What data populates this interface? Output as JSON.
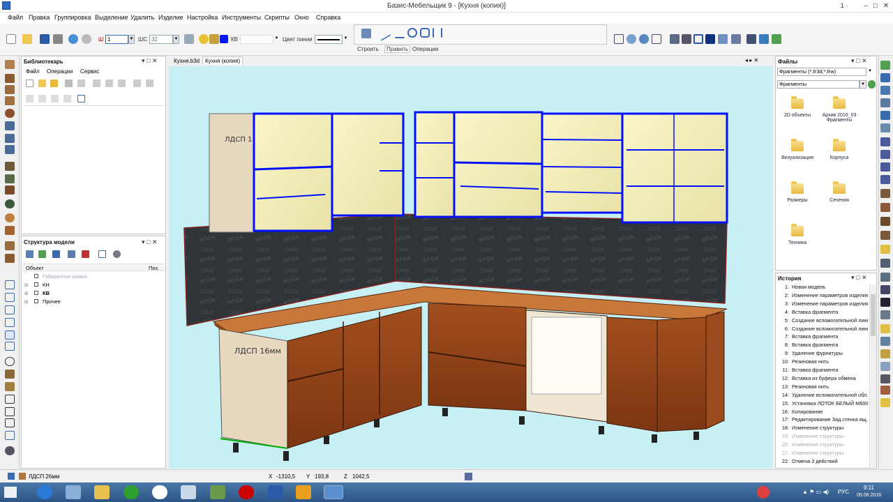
{
  "window": {
    "title": "Базис-Мебельщик 9 - [Кухня (копия)]",
    "version_indicator": "1 ·"
  },
  "menu": [
    "Файл",
    "Правка",
    "Группировка",
    "Выделение",
    "Удалить",
    "Изделие",
    "Настройка",
    "Инструменты",
    "Скрипты",
    "Окно",
    "Справка"
  ],
  "toolbar": {
    "w_label": "Ш",
    "w_value": "1",
    "ws_label": "ШС",
    "ws_value": "32",
    "kv_label": "КВ",
    "line_color_label": "Цвет линии",
    "tabs": [
      "Строить",
      "Править",
      "Операции"
    ]
  },
  "doc_tabs": [
    "Кухня.b3d",
    "Кухня (копия)"
  ],
  "librarian": {
    "title": "Библиотекарь",
    "menu": [
      "Файл",
      "Операции",
      "Сервис"
    ]
  },
  "model_structure": {
    "title": "Структура модели",
    "col_object": "Объект",
    "col_pos": "Поз.",
    "items": [
      {
        "label": "Габаритная рамка",
        "faded": true,
        "bold": false
      },
      {
        "label": "КН",
        "faded": false,
        "bold": false
      },
      {
        "label": "КВ",
        "faded": false,
        "bold": true
      },
      {
        "label": "Прочее",
        "faded": false,
        "bold": false
      }
    ]
  },
  "viewport": {
    "label_upper": "ЛДСП 1",
    "label_lower": "ЛДСП 16мм",
    "bg": "#c6f0f4"
  },
  "files": {
    "title": "Файлы",
    "filter": "Фрагменты (*.fr3d;*.frw)",
    "folder": "Фрагменты",
    "items": [
      "2D объекты",
      "Архив 2016_03 Фрагменты",
      "Визуализация",
      "Корпуса",
      "Размеры",
      "Сечения",
      "Техника"
    ]
  },
  "history": {
    "title": "История",
    "items": [
      {
        "n": "1:",
        "t": "Новая модель",
        "faded": false
      },
      {
        "n": "2:",
        "t": "Изменение параметров изделия",
        "faded": false
      },
      {
        "n": "3:",
        "t": "Изменение параметров изделия",
        "faded": false
      },
      {
        "n": "4:",
        "t": "Вставка фрагмента",
        "faded": false
      },
      {
        "n": "5:",
        "t": "Создание вспомогательной линии",
        "faded": false
      },
      {
        "n": "6:",
        "t": "Создание вспомогательной линии",
        "faded": false
      },
      {
        "n": "7:",
        "t": "Вставка фрагмента",
        "faded": false
      },
      {
        "n": "8:",
        "t": "Вставка фрагмента",
        "faded": false
      },
      {
        "n": "9:",
        "t": "Удаление фурнитуры",
        "faded": false
      },
      {
        "n": "10:",
        "t": "Резиновая нить",
        "faded": false
      },
      {
        "n": "11:",
        "t": "Вставка фрагмента",
        "faded": false
      },
      {
        "n": "12:",
        "t": "Вставка из буфера обмена",
        "faded": false
      },
      {
        "n": "13:",
        "t": "Резиновая нить",
        "faded": false
      },
      {
        "n": "14:",
        "t": "Удаление вспомогательной обл.",
        "faded": false
      },
      {
        "n": "15:",
        "t": "Установка ЛОТОК БЕЛЫЙ М600",
        "faded": false
      },
      {
        "n": "16:",
        "t": "Копирование",
        "faded": false
      },
      {
        "n": "17:",
        "t": "Редактирование Зад.стенка ящ.",
        "faded": false
      },
      {
        "n": "18:",
        "t": "Изменение структуры",
        "faded": false
      },
      {
        "n": "19:",
        "t": "Изменение структуры",
        "faded": true
      },
      {
        "n": "20:",
        "t": "Изменение структуры",
        "faded": true
      },
      {
        "n": "21:",
        "t": "Изменение структуры",
        "faded": true
      },
      {
        "n": "22:",
        "t": "Отмена 3 действий",
        "faded": false
      }
    ]
  },
  "status": {
    "material": "ЛДСП 26мм",
    "x_label": "X",
    "x_value": "-1310,5",
    "y_label": "Y",
    "y_value": "193,8",
    "z_label": "Z",
    "z_value": "1042,5"
  },
  "taskbar": {
    "lang": "РУС",
    "time": "9:11",
    "date": "05.06.2016"
  }
}
